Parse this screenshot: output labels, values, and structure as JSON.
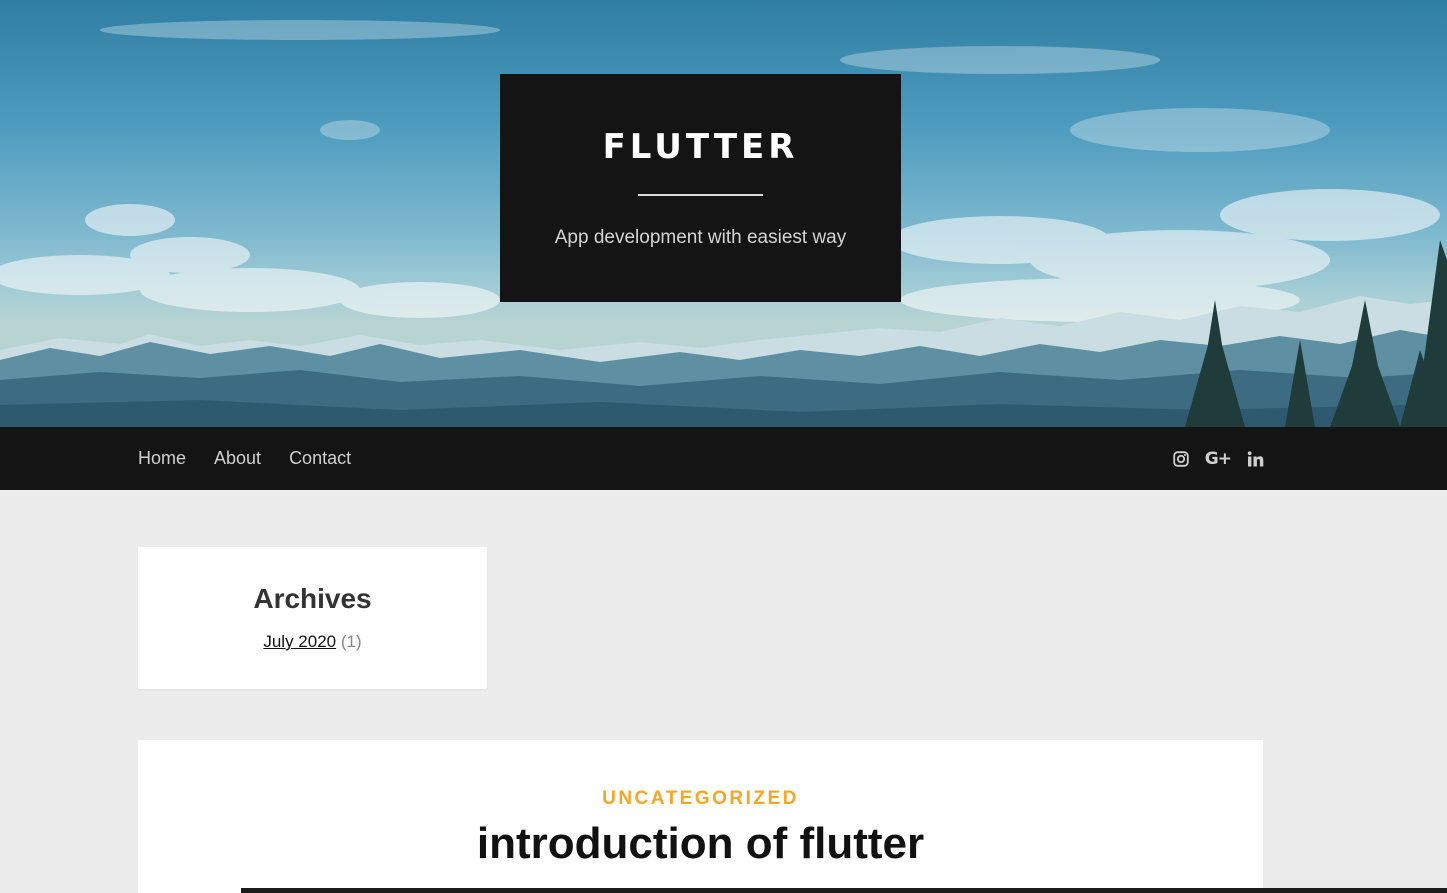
{
  "hero": {
    "site_title": "FLUTTER",
    "tagline": "App development with easiest way"
  },
  "nav": {
    "items": [
      {
        "label": "Home"
      },
      {
        "label": "About"
      },
      {
        "label": "Contact"
      }
    ],
    "social": [
      {
        "icon": "instagram-icon"
      },
      {
        "icon": "google-plus-icon",
        "glyph": "G+"
      },
      {
        "icon": "linkedin-icon"
      }
    ]
  },
  "widget": {
    "title": "Archives",
    "archive_link": "July 2020",
    "archive_count": "(1)"
  },
  "post": {
    "category": "UNCATEGORIZED",
    "title": "introduction of flutter"
  },
  "colors": {
    "dark": "#141414",
    "accent": "#f5a623",
    "page_bg": "#ececec"
  }
}
